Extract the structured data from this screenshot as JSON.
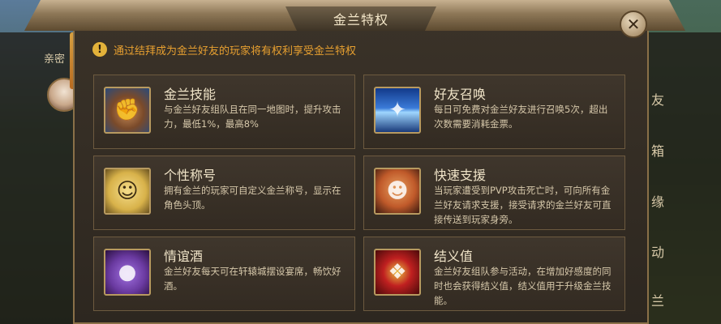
{
  "dialog": {
    "title": "金兰特权",
    "close_icon": "close-icon"
  },
  "left_panel": {
    "tab_label": "亲密"
  },
  "right_panel": {
    "tabs": [
      "友",
      "箱",
      "缘",
      "动",
      "兰"
    ]
  },
  "notice": {
    "icon": "exclamation-icon",
    "text": "通过结拜成为金兰好友的玩家将有权利享受金兰特权"
  },
  "privileges": [
    {
      "title": "金兰技能",
      "icon": "fist-icon",
      "desc": "与金兰好友组队且在同一地图时，提升攻击力，最低1%，最高8%"
    },
    {
      "title": "好友召唤",
      "icon": "summon-icon",
      "desc": "每日可免费对金兰好友进行召唤5次，超出次数需要消耗金票。"
    },
    {
      "title": "个性称号",
      "icon": "title-book-icon",
      "desc": "拥有金兰的玩家可自定义金兰称号，显示在角色头顶。"
    },
    {
      "title": "快速支援",
      "icon": "shout-icon",
      "desc": "当玩家遭受到PVP攻击死亡时，可向所有金兰好友请求支援，接受请求的金兰好友可直接传送到玩家身旁。"
    },
    {
      "title": "情谊酒",
      "icon": "wine-gourd-icon",
      "desc": "金兰好友每天可在轩辕城摆设宴席，畅饮好酒。"
    },
    {
      "title": "结义值",
      "icon": "chinese-knot-icon",
      "desc": "金兰好友组队参与活动，在增加好感度的同时也会获得结义值，结义值用于升级金兰技能。"
    }
  ]
}
